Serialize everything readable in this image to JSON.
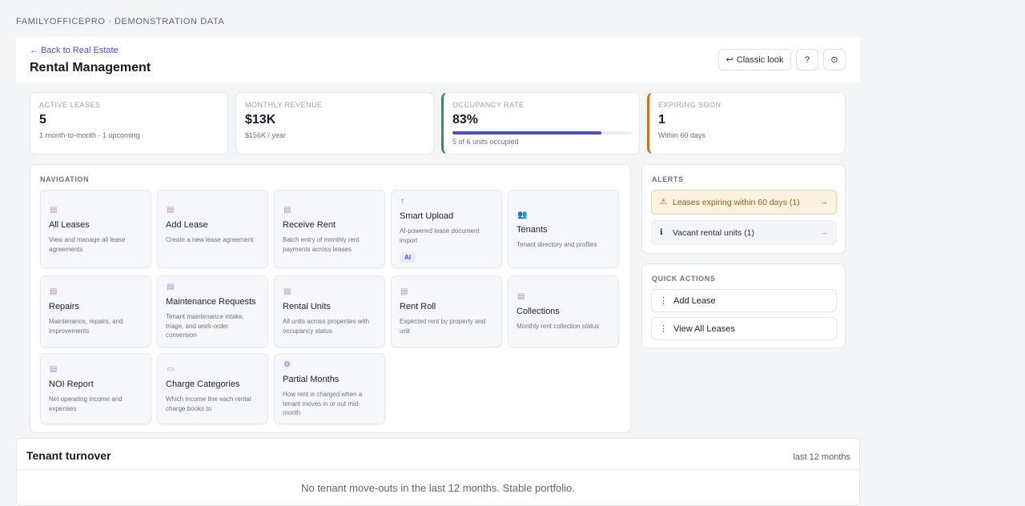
{
  "brand": "FAMILYOFFICEPRO · DEMONSTRATION DATA",
  "header": {
    "back_link": "← Back to Real Estate",
    "title": "Rental Management",
    "classic_label": "Classic look",
    "classic_icon": "↩",
    "help_label": "?",
    "theme_icon": "⊙"
  },
  "stats": [
    {
      "label": "ACTIVE LEASES",
      "value": "5",
      "sub": "1 month-to-month · 1 upcoming"
    },
    {
      "label": "MONTHLY REVENUE",
      "value": "$13K",
      "sub": "$156K / year"
    },
    {
      "label": "OCCUPANCY RATE",
      "value": "83%",
      "sub": "5 of 6 units occupied",
      "progress_percent": 83,
      "accent": "#1f9d55"
    },
    {
      "label": "EXPIRING SOON",
      "value": "1",
      "sub": "Within 60 days",
      "accent": "#c7771a"
    }
  ],
  "navigation": {
    "title": "NAVIGATION",
    "tiles": [
      {
        "icon": "document-icon",
        "glyph": "▤",
        "title": "All Leases",
        "desc": "View and manage all lease agreements"
      },
      {
        "icon": "document-icon",
        "glyph": "▤",
        "title": "Add Lease",
        "desc": "Create a new lease agreement"
      },
      {
        "icon": "document-icon",
        "glyph": "▤",
        "title": "Receive Rent",
        "desc": "Batch entry of monthly rent payments across leases"
      },
      {
        "icon": "upload-icon",
        "glyph": "↑",
        "title": "Smart Upload",
        "desc": "AI-powered lease document import",
        "badge": "AI"
      },
      {
        "icon": "people-icon",
        "glyph": "👥",
        "title": "Tenants",
        "desc": "Tenant directory and profiles"
      },
      {
        "icon": "document-icon",
        "glyph": "▤",
        "title": "Repairs",
        "desc": "Maintenance, repairs, and improvements"
      },
      {
        "icon": "document-icon",
        "glyph": "▤",
        "title": "Maintenance Requests",
        "desc": "Tenant maintenance intake, triage, and work-order conversion"
      },
      {
        "icon": "document-icon",
        "glyph": "▤",
        "title": "Rental Units",
        "desc": "All units across properties with occupancy status"
      },
      {
        "icon": "document-icon",
        "glyph": "▤",
        "title": "Rent Roll",
        "desc": "Expected rent by property and unit"
      },
      {
        "icon": "document-icon",
        "glyph": "▤",
        "title": "Collections",
        "desc": "Monthly rent collection status"
      },
      {
        "icon": "document-icon",
        "glyph": "▤",
        "title": "NOI Report",
        "desc": "Net operating income and expenses"
      },
      {
        "icon": "tag-icon",
        "glyph": "▭",
        "title": "Charge Categories",
        "desc": "Which income line each rental charge books to"
      },
      {
        "icon": "gear-icon",
        "glyph": "⚙",
        "title": "Partial Months",
        "desc": "How rent is charged when a tenant moves in or out mid-month"
      }
    ]
  },
  "alerts": {
    "title": "ALERTS",
    "items": [
      {
        "icon": "⚠",
        "text": "Leases expiring within 60 days (1)",
        "arrow": "→"
      },
      {
        "icon": "ℹ",
        "text": "Vacant rental units (1)",
        "arrow": "→"
      }
    ]
  },
  "quick_actions": {
    "title": "QUICK ACTIONS",
    "items": [
      {
        "icon": "⋮",
        "label": "Add Lease"
      },
      {
        "icon": "⋮",
        "label": "View All Leases"
      }
    ]
  },
  "turnover": {
    "title": "Tenant turnover",
    "range": "last 12 months",
    "empty": "No tenant move-outs in the last 12 months. Stable portfolio."
  }
}
